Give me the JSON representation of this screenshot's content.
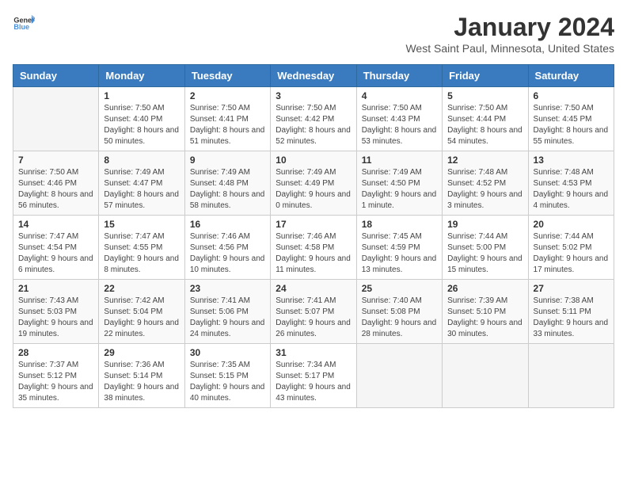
{
  "header": {
    "logo_general": "General",
    "logo_blue": "Blue",
    "month_year": "January 2024",
    "location": "West Saint Paul, Minnesota, United States"
  },
  "columns": [
    "Sunday",
    "Monday",
    "Tuesday",
    "Wednesday",
    "Thursday",
    "Friday",
    "Saturday"
  ],
  "weeks": [
    [
      null,
      {
        "day": 1,
        "sunrise": "7:50 AM",
        "sunset": "4:40 PM",
        "daylight": "8 hours and 50 minutes."
      },
      {
        "day": 2,
        "sunrise": "7:50 AM",
        "sunset": "4:41 PM",
        "daylight": "8 hours and 51 minutes."
      },
      {
        "day": 3,
        "sunrise": "7:50 AM",
        "sunset": "4:42 PM",
        "daylight": "8 hours and 52 minutes."
      },
      {
        "day": 4,
        "sunrise": "7:50 AM",
        "sunset": "4:43 PM",
        "daylight": "8 hours and 53 minutes."
      },
      {
        "day": 5,
        "sunrise": "7:50 AM",
        "sunset": "4:44 PM",
        "daylight": "8 hours and 54 minutes."
      },
      {
        "day": 6,
        "sunrise": "7:50 AM",
        "sunset": "4:45 PM",
        "daylight": "8 hours and 55 minutes."
      }
    ],
    [
      {
        "day": 7,
        "sunrise": "7:50 AM",
        "sunset": "4:46 PM",
        "daylight": "8 hours and 56 minutes."
      },
      {
        "day": 8,
        "sunrise": "7:49 AM",
        "sunset": "4:47 PM",
        "daylight": "8 hours and 57 minutes."
      },
      {
        "day": 9,
        "sunrise": "7:49 AM",
        "sunset": "4:48 PM",
        "daylight": "8 hours and 58 minutes."
      },
      {
        "day": 10,
        "sunrise": "7:49 AM",
        "sunset": "4:49 PM",
        "daylight": "9 hours and 0 minutes."
      },
      {
        "day": 11,
        "sunrise": "7:49 AM",
        "sunset": "4:50 PM",
        "daylight": "9 hours and 1 minute."
      },
      {
        "day": 12,
        "sunrise": "7:48 AM",
        "sunset": "4:52 PM",
        "daylight": "9 hours and 3 minutes."
      },
      {
        "day": 13,
        "sunrise": "7:48 AM",
        "sunset": "4:53 PM",
        "daylight": "9 hours and 4 minutes."
      }
    ],
    [
      {
        "day": 14,
        "sunrise": "7:47 AM",
        "sunset": "4:54 PM",
        "daylight": "9 hours and 6 minutes."
      },
      {
        "day": 15,
        "sunrise": "7:47 AM",
        "sunset": "4:55 PM",
        "daylight": "9 hours and 8 minutes."
      },
      {
        "day": 16,
        "sunrise": "7:46 AM",
        "sunset": "4:56 PM",
        "daylight": "9 hours and 10 minutes."
      },
      {
        "day": 17,
        "sunrise": "7:46 AM",
        "sunset": "4:58 PM",
        "daylight": "9 hours and 11 minutes."
      },
      {
        "day": 18,
        "sunrise": "7:45 AM",
        "sunset": "4:59 PM",
        "daylight": "9 hours and 13 minutes."
      },
      {
        "day": 19,
        "sunrise": "7:44 AM",
        "sunset": "5:00 PM",
        "daylight": "9 hours and 15 minutes."
      },
      {
        "day": 20,
        "sunrise": "7:44 AM",
        "sunset": "5:02 PM",
        "daylight": "9 hours and 17 minutes."
      }
    ],
    [
      {
        "day": 21,
        "sunrise": "7:43 AM",
        "sunset": "5:03 PM",
        "daylight": "9 hours and 19 minutes."
      },
      {
        "day": 22,
        "sunrise": "7:42 AM",
        "sunset": "5:04 PM",
        "daylight": "9 hours and 22 minutes."
      },
      {
        "day": 23,
        "sunrise": "7:41 AM",
        "sunset": "5:06 PM",
        "daylight": "9 hours and 24 minutes."
      },
      {
        "day": 24,
        "sunrise": "7:41 AM",
        "sunset": "5:07 PM",
        "daylight": "9 hours and 26 minutes."
      },
      {
        "day": 25,
        "sunrise": "7:40 AM",
        "sunset": "5:08 PM",
        "daylight": "9 hours and 28 minutes."
      },
      {
        "day": 26,
        "sunrise": "7:39 AM",
        "sunset": "5:10 PM",
        "daylight": "9 hours and 30 minutes."
      },
      {
        "day": 27,
        "sunrise": "7:38 AM",
        "sunset": "5:11 PM",
        "daylight": "9 hours and 33 minutes."
      }
    ],
    [
      {
        "day": 28,
        "sunrise": "7:37 AM",
        "sunset": "5:12 PM",
        "daylight": "9 hours and 35 minutes."
      },
      {
        "day": 29,
        "sunrise": "7:36 AM",
        "sunset": "5:14 PM",
        "daylight": "9 hours and 38 minutes."
      },
      {
        "day": 30,
        "sunrise": "7:35 AM",
        "sunset": "5:15 PM",
        "daylight": "9 hours and 40 minutes."
      },
      {
        "day": 31,
        "sunrise": "7:34 AM",
        "sunset": "5:17 PM",
        "daylight": "9 hours and 43 minutes."
      },
      null,
      null,
      null
    ]
  ]
}
